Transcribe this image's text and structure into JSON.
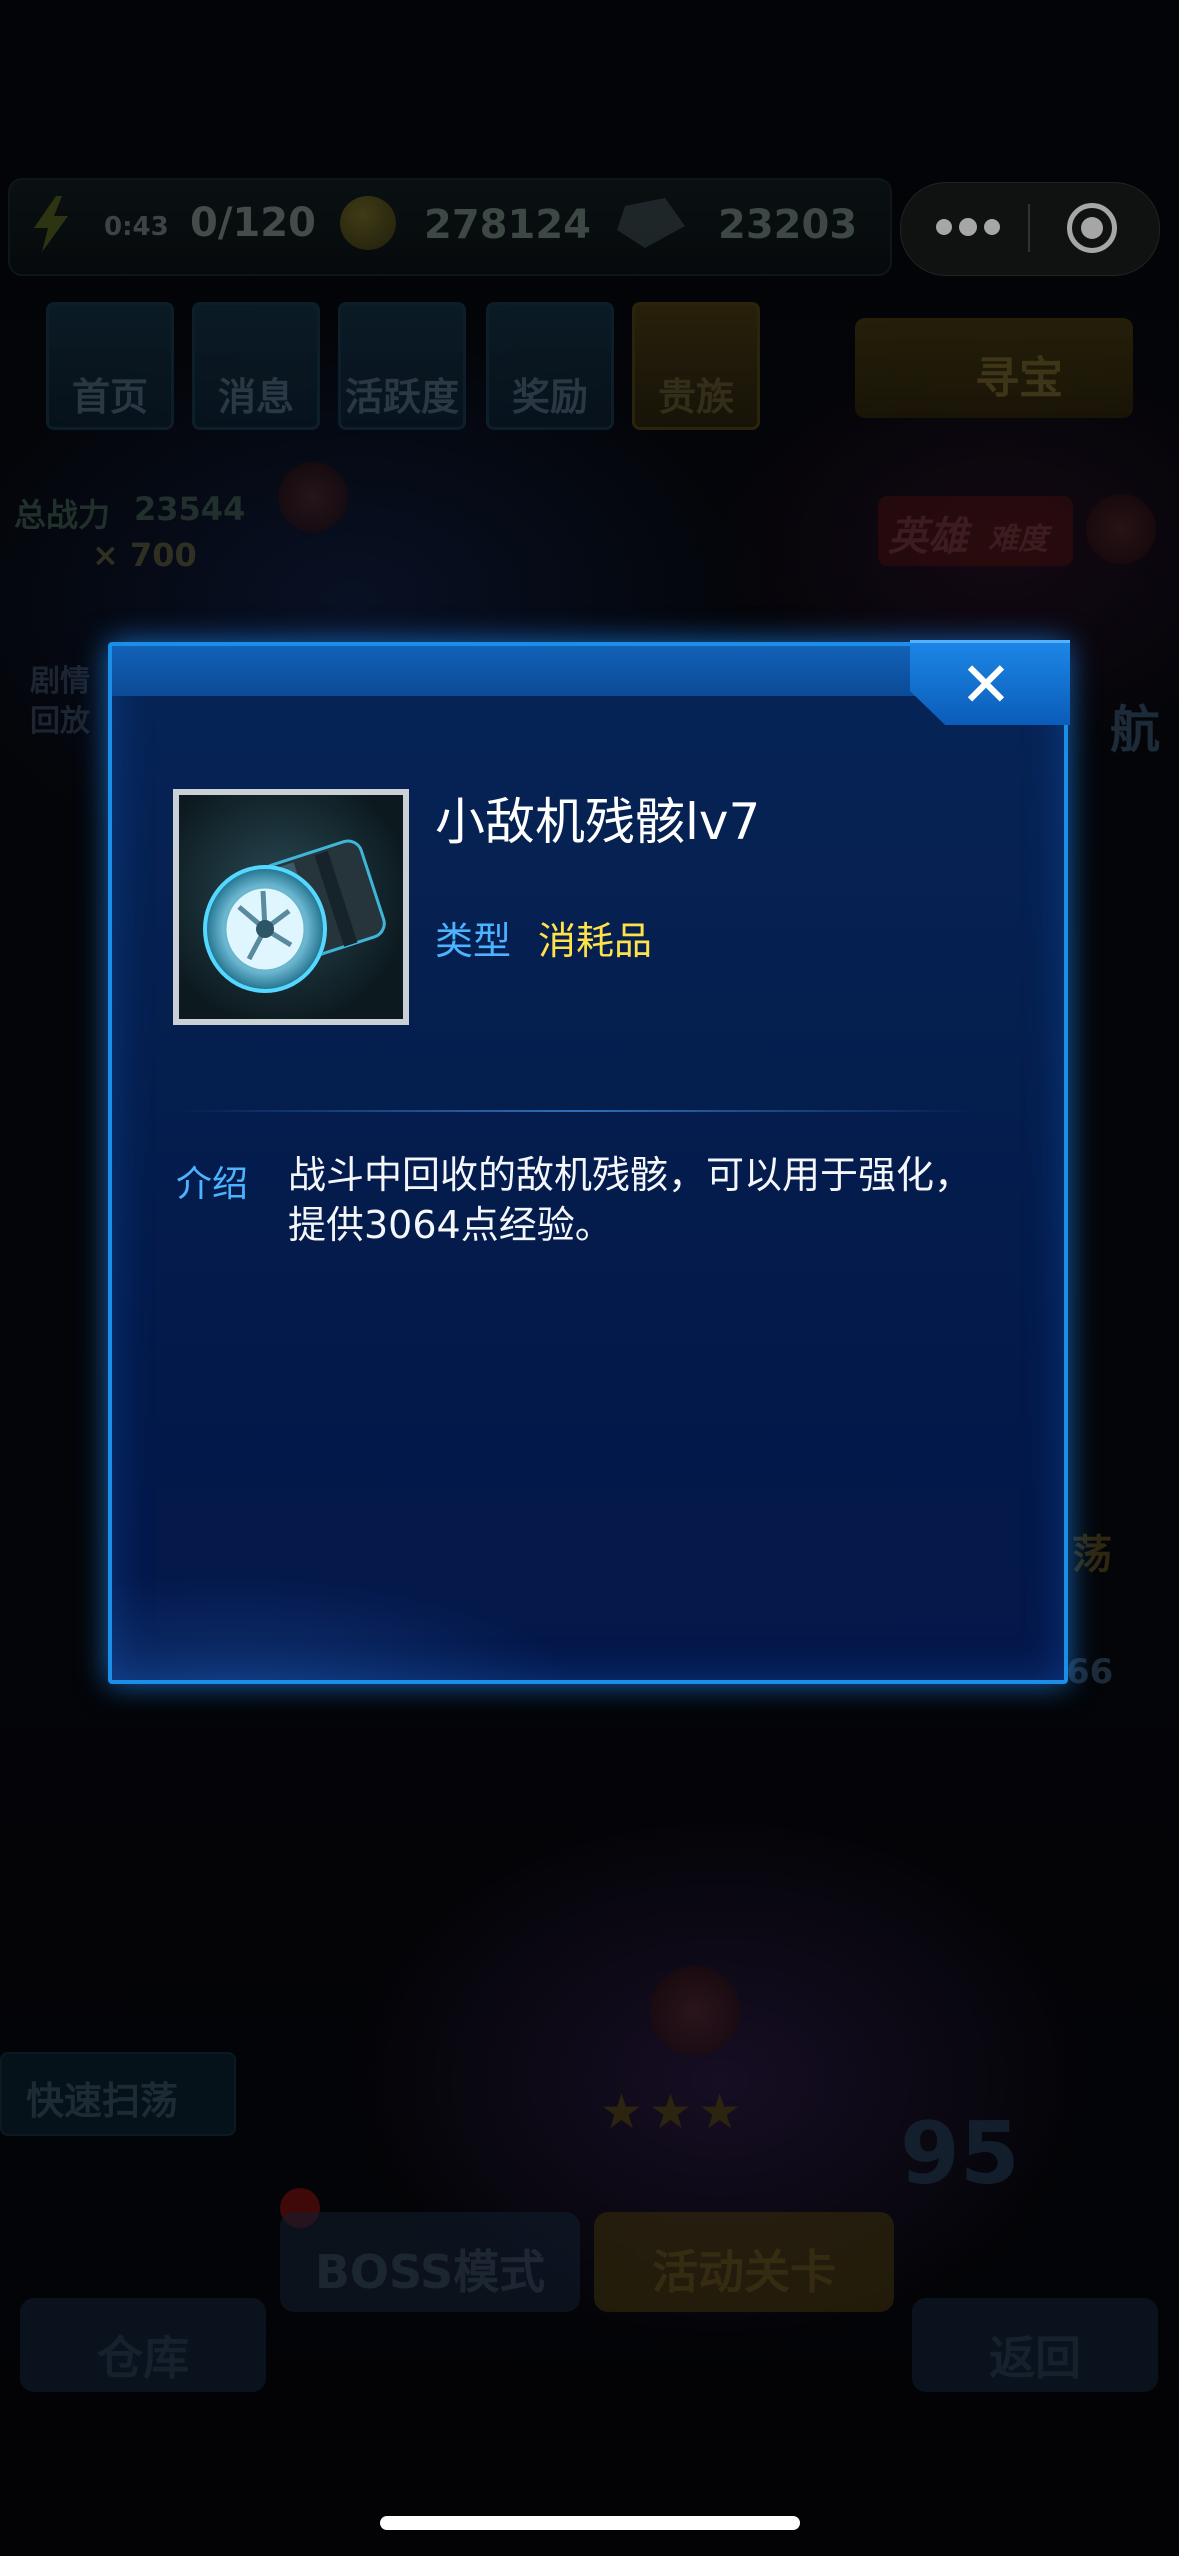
{
  "topbar": {
    "timer": "0:43",
    "energy": "0/120",
    "coins": "278124",
    "gems": "23203"
  },
  "nav": {
    "items": [
      "首页",
      "消息",
      "活跃度",
      "奖励",
      "贵族"
    ],
    "treasure": "寻宝"
  },
  "side": {
    "power_label": "总战力",
    "power_value": "23544",
    "key_count": "× 700",
    "story_line1": "剧情",
    "story_line2": "回放",
    "hero_mode": "英雄",
    "hero_difficulty": "难度",
    "nav_partial": "航",
    "sweep_partial": "荡",
    "count_partial": "66"
  },
  "bottom": {
    "quick_sweep": "快速扫荡",
    "boss_mode": "BOSS模式",
    "event_level": "活动关卡",
    "warehouse": "仓库",
    "back": "返回",
    "level_number": "95"
  },
  "dialog": {
    "close": "✕",
    "item_name": "小敌机残骸lv7",
    "type_label": "类型",
    "type_value": "消耗品",
    "intro_label": "介绍",
    "intro_line1": "战斗中回收的敌机残骸，可以用于强化，",
    "intro_line2": "提供3064点经验。"
  },
  "colors": {
    "dialog_border": "#1b8fe8",
    "label_blue": "#4db3ff",
    "type_yellow": "#ffe24a"
  }
}
